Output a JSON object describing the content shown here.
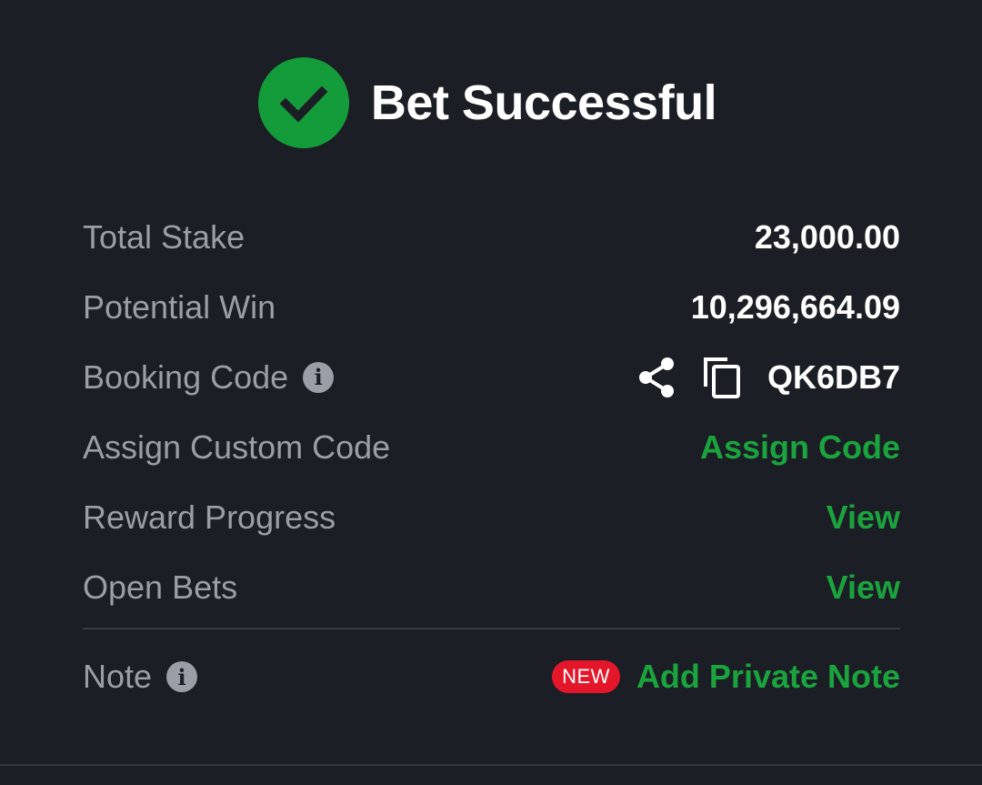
{
  "header": {
    "title": "Bet Successful",
    "icon": "check-circle-icon",
    "accent_color": "#149b3a"
  },
  "rows": {
    "total_stake": {
      "label": "Total Stake",
      "value": "23,000.00"
    },
    "potential_win": {
      "label": "Potential Win",
      "value": "10,296,664.09"
    },
    "booking_code": {
      "label": "Booking Code",
      "value": "QK6DB7",
      "icons": [
        "info-icon",
        "share-icon",
        "copy-icon"
      ]
    },
    "custom_code": {
      "label": "Assign Custom Code",
      "action": "Assign Code"
    },
    "reward_progress": {
      "label": "Reward Progress",
      "action": "View"
    },
    "open_bets": {
      "label": "Open Bets",
      "action": "View"
    },
    "note": {
      "label": "Note",
      "badge": "NEW",
      "action": "Add Private Note"
    }
  },
  "colors": {
    "background": "#1c1e25",
    "label": "#9b9ea6",
    "link": "#1ba33e",
    "badge": "#e4172a"
  }
}
